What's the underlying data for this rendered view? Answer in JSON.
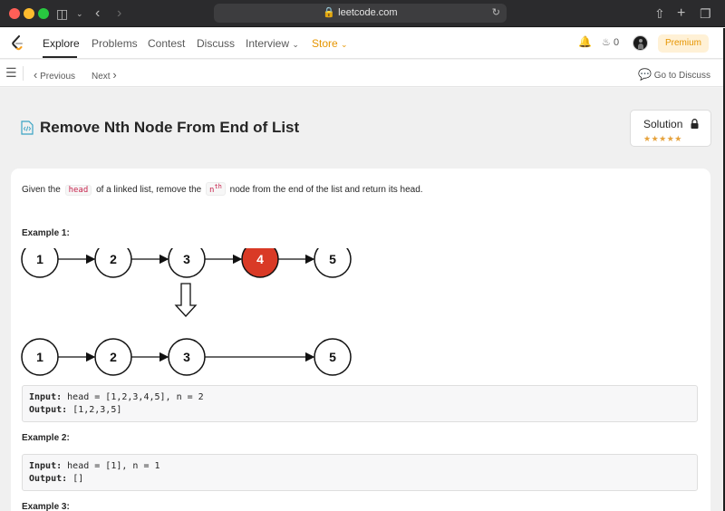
{
  "browser": {
    "url": "leetcode.com"
  },
  "navbar": {
    "items": [
      {
        "label": "Explore",
        "active": true
      },
      {
        "label": "Problems"
      },
      {
        "label": "Contest"
      },
      {
        "label": "Discuss"
      },
      {
        "label": "Interview"
      },
      {
        "label": "Store"
      }
    ],
    "coins": "0",
    "premium_label": "Premium"
  },
  "subbar": {
    "previous_label": "Previous",
    "next_label": "Next",
    "discuss_label": "Go to Discuss"
  },
  "problem": {
    "title": "Remove Nth Node From End of List",
    "solution_label": "Solution",
    "rating": 4.5,
    "description": {
      "part1": "Given the",
      "code1": "head",
      "part2": "of a linked list, remove the",
      "code2_base": "n",
      "code2_sup": "th",
      "part3": "node from the end of the list and return its head."
    }
  },
  "examples": [
    {
      "label": "Example 1:",
      "input_label": "Input:",
      "input": "head = [1,2,3,4,5], n = 2",
      "output_label": "Output:",
      "output": "[1,2,3,5]"
    },
    {
      "label": "Example 2:",
      "input_label": "Input:",
      "input": "head = [1], n = 1",
      "output_label": "Output:",
      "output": "[]"
    },
    {
      "label": "Example 3:"
    }
  ],
  "diagram": {
    "before": [
      "1",
      "2",
      "3",
      "4",
      "5"
    ],
    "removed_index": 3,
    "after": [
      "1",
      "2",
      "3",
      "5"
    ],
    "highlight_color": "#d93a26"
  }
}
